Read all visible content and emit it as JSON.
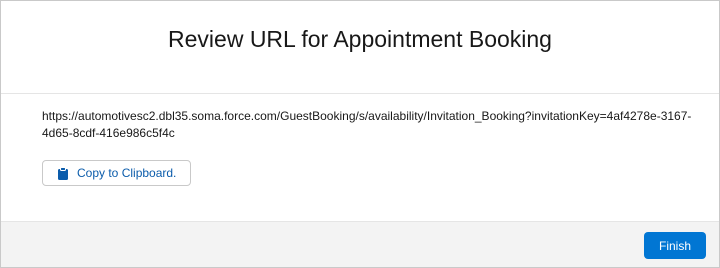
{
  "modal": {
    "title": "Review URL for Appointment Booking"
  },
  "body": {
    "url": "https://automotivesc2.dbl35.soma.force.com/GuestBooking/s/availability/Invitation_Booking?invitationKey=4af4278e-3167-4d65-8cdf-416e986c5f4c",
    "copy_button_label": "Copy to Clipboard.",
    "copy_icon": "clipboard-icon"
  },
  "footer": {
    "finish_label": "Finish"
  },
  "colors": {
    "primary": "#0176d3",
    "link": "#0b5cab",
    "footer_bg": "#f3f3f3",
    "border": "#c9c9c9"
  }
}
